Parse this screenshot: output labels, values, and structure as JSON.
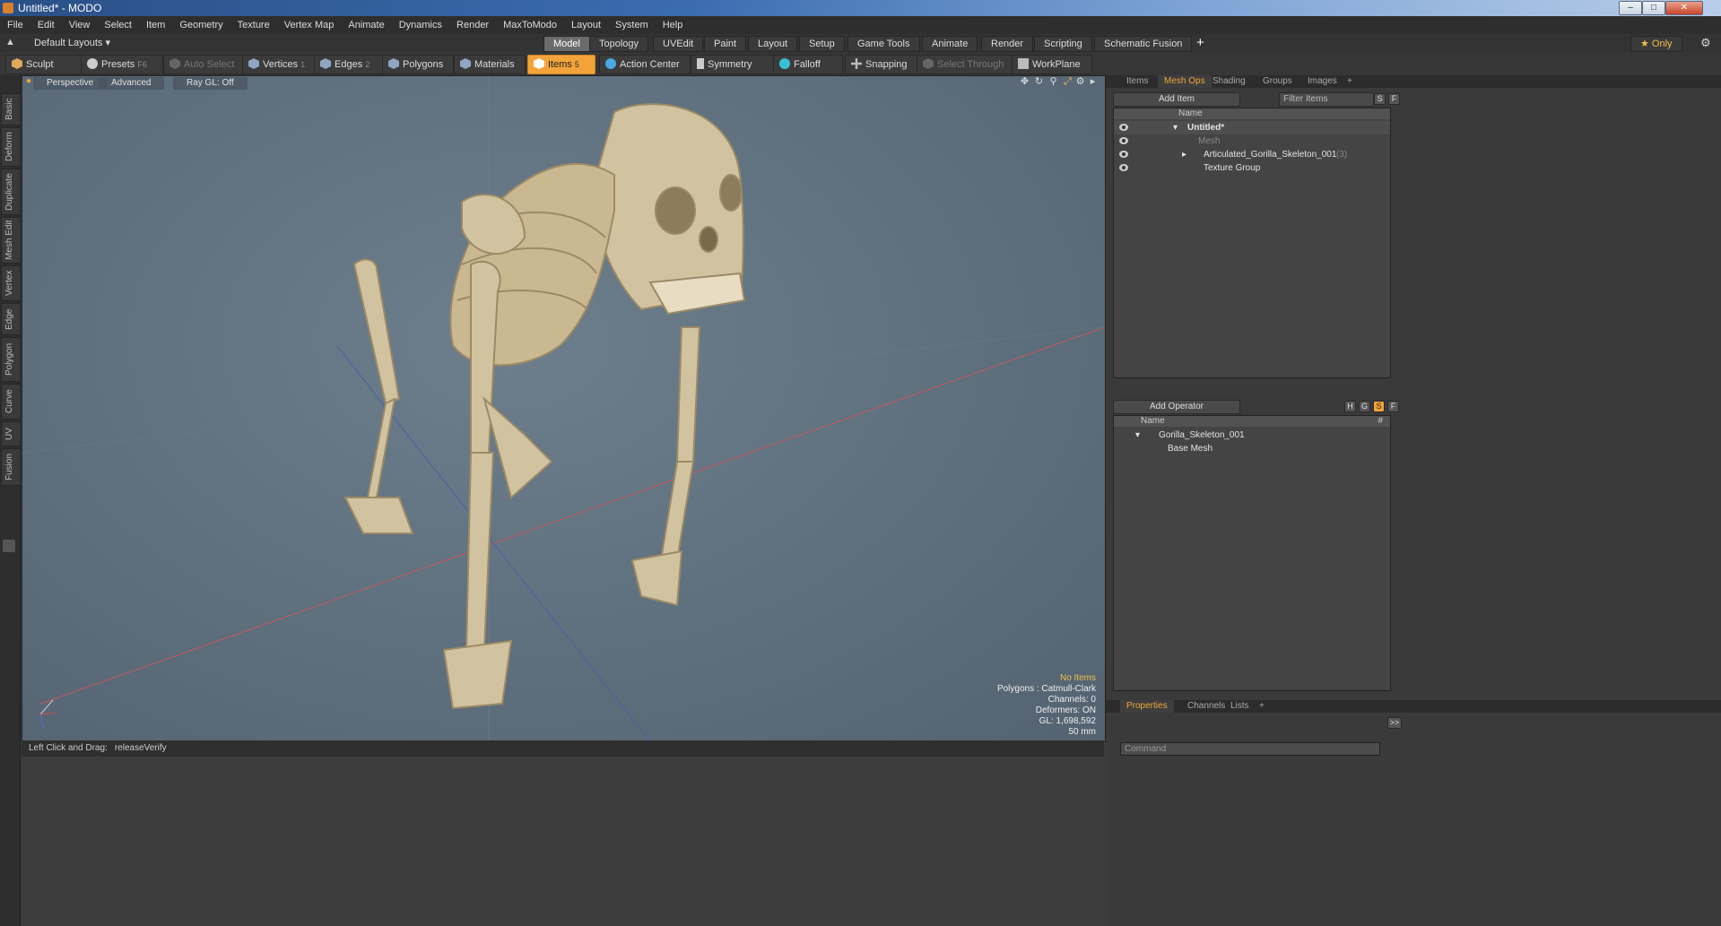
{
  "window": {
    "title": "Untitled* - MODO",
    "controls": [
      "–",
      "□",
      "✕"
    ]
  },
  "menubar": [
    "File",
    "Edit",
    "View",
    "Select",
    "Item",
    "Geometry",
    "Texture",
    "Vertex Map",
    "Animate",
    "Dynamics",
    "Render",
    "MaxToModo",
    "Layout",
    "System",
    "Help"
  ],
  "layoutbar": {
    "layout_name": "Default Layouts ▾",
    "tabs": [
      "Model",
      "Topology",
      "UVEdit",
      "Paint",
      "Layout",
      "Setup",
      "Game Tools",
      "Animate",
      "Render",
      "Scripting",
      "Schematic Fusion"
    ],
    "active_tab": "Model",
    "add": "+",
    "only_label": "★ Only",
    "gear": "⚙"
  },
  "toolbar": {
    "sculpt": "Sculpt",
    "presets": "Presets",
    "presets_key": "F6",
    "auto_select": "Auto Select",
    "vertices": "Vertices",
    "vertices_key": "1",
    "edges": "Edges",
    "edges_key": "2",
    "polygons": "Polygons",
    "materials": "Materials",
    "items": "Items",
    "items_key": "5",
    "action_center": "Action Center",
    "symmetry": "Symmetry",
    "falloff": "Falloff",
    "snapping": "Snapping",
    "select_through": "Select Through",
    "workplane": "WorkPlane"
  },
  "left_tabs": [
    "Basic",
    "Deform",
    "Duplicate",
    "Mesh Edit",
    "Vertex",
    "Edge",
    "Polygon",
    "Curve",
    "UV",
    "Fusion"
  ],
  "viewport": {
    "view": "Perspective",
    "shading": "Advanced",
    "raygl": "Ray GL: Off",
    "info": {
      "items": "No Items",
      "polygons": "Polygons : Catmull-Clark",
      "channels": "Channels: 0",
      "deformers": "Deformers: ON",
      "gl": "GL: 1,698,592",
      "size": "50 mm"
    }
  },
  "status": {
    "hint": "Left Click and Drag:",
    "action": "releaseVerify"
  },
  "right_panel": {
    "tabs": [
      "Items",
      "Mesh Ops",
      "Shading",
      "Groups",
      "Images",
      "+"
    ],
    "active_tab": "Mesh Ops",
    "add_item": "Add Item",
    "filter_items": "Filter Items",
    "s_btn": "S",
    "f_btn": "F",
    "name_header": "Name",
    "tree": [
      {
        "label": "Untitled*",
        "bold": true
      },
      {
        "label": "Mesh",
        "dim": true
      },
      {
        "label": "Articulated_Gorilla_Skeleton_001",
        "count": "(3)"
      },
      {
        "label": "Texture Group"
      }
    ],
    "add_operator": "Add Operator",
    "op_flags": [
      "H",
      "G",
      "S",
      "F"
    ],
    "op_header": "Name",
    "op_hash": "#",
    "operators": [
      {
        "label": "Gorilla_Skeleton_001"
      },
      {
        "label": "Base Mesh"
      }
    ],
    "bottom_tabs": [
      "Properties",
      "Channels",
      "Lists",
      "+"
    ],
    "active_bottom_tab": "Properties",
    "expand": ">>",
    "command_placeholder": "Command"
  },
  "colors": {
    "accent": "#f2a43a",
    "viewport_bg": "#5e6f7d",
    "panel_bg": "#3a3a3a"
  }
}
